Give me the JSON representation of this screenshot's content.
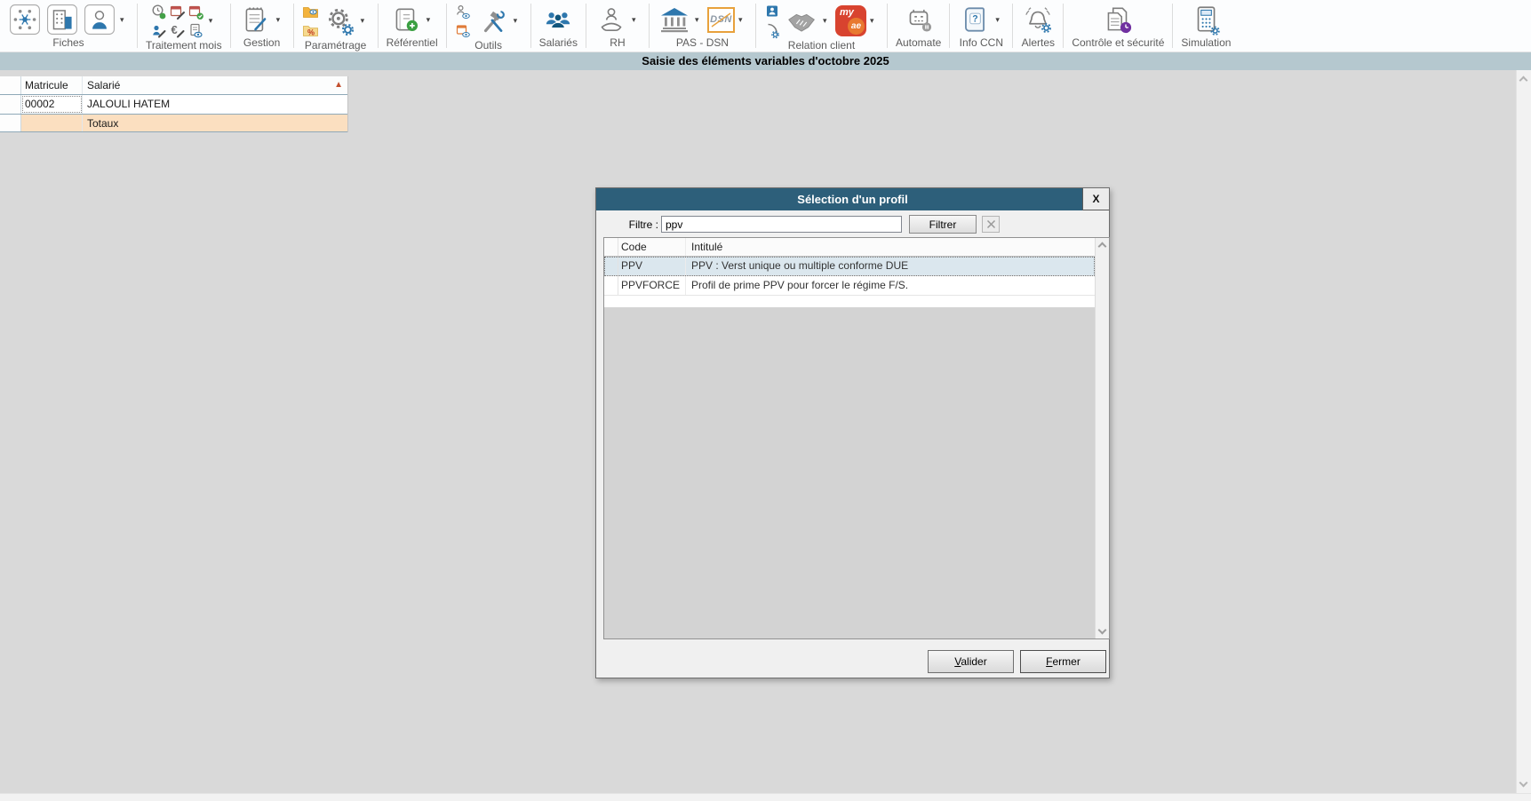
{
  "colors": {
    "band-bg": "#b5c8cf",
    "content-bg": "#d9d9d9",
    "dialog-title-bg": "#2d5f7a",
    "dialog-bg": "#f0f0f0",
    "selected-row-bg": "#dbe7ee",
    "totals-row-bg": "#fbdfc0",
    "accent-blue": "#2e77ad"
  },
  "ribbon": {
    "groups": [
      {
        "label": "Fiches"
      },
      {
        "label": "Traitement mois"
      },
      {
        "label": "Gestion"
      },
      {
        "label": "Paramétrage"
      },
      {
        "label": "Référentiel"
      },
      {
        "label": "Outils"
      },
      {
        "label": "Salariés"
      },
      {
        "label": "RH"
      },
      {
        "label": "PAS - DSN"
      },
      {
        "label": "Relation client"
      },
      {
        "label": "Automate"
      },
      {
        "label": "Info CCN"
      },
      {
        "label": "Alertes"
      },
      {
        "label": "Contrôle et sécurité"
      },
      {
        "label": "Simulation"
      }
    ],
    "dsn_logo_text": "DSN",
    "myae_my": "my",
    "myae_ae": "ae"
  },
  "band": {
    "title": "Saisie des éléments variables d'octobre 2025"
  },
  "employee_table": {
    "columns": {
      "matricule": "Matricule",
      "salarie": "Salarié"
    },
    "rows": [
      {
        "matricule": "00002",
        "salarie": "JALOULI HATEM"
      }
    ],
    "totals_label": "Totaux"
  },
  "dialog": {
    "title": "Sélection d'un profil",
    "close_label": "X",
    "filter_label": "Filtre :",
    "filter_value": "ppv",
    "filter_button": "Filtrer",
    "columns": {
      "code": "Code",
      "intitule": "Intitulé"
    },
    "rows": [
      {
        "code": "PPV",
        "intitule": "PPV : Verst unique ou multiple conforme DUE",
        "selected": true
      },
      {
        "code": "PPVFORCE",
        "intitule": "Profil de prime PPV pour forcer le régime F/S.",
        "selected": false
      }
    ],
    "buttons": {
      "validate": "Valider",
      "close": "Fermer"
    }
  }
}
